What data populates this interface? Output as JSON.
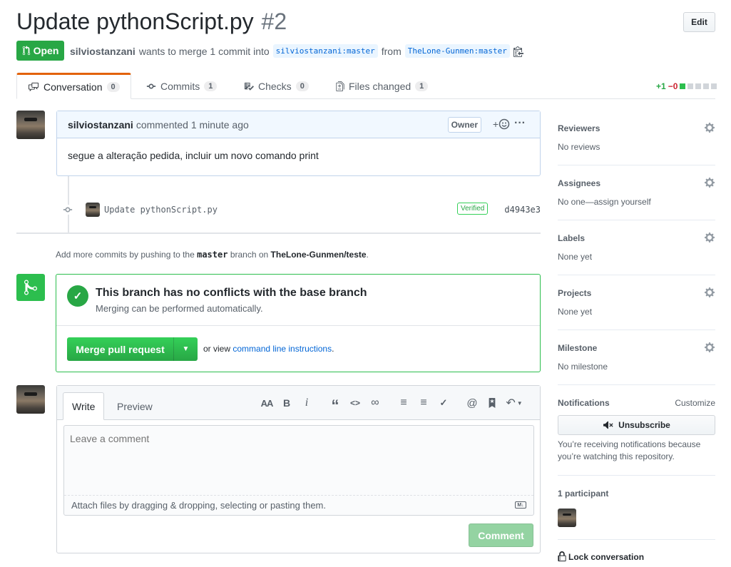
{
  "header": {
    "title": "Update pythonScript.py",
    "number": "#2",
    "edit_label": "Edit",
    "state": "Open",
    "author": "silviostanzani",
    "merge_text": "wants to merge 1 commit into",
    "base_branch": "silviostanzani:master",
    "from_text": "from",
    "head_branch": "TheLone-Gunmen:master"
  },
  "tabs": [
    {
      "label": "Conversation",
      "count": "0",
      "icon": "comment-icon"
    },
    {
      "label": "Commits",
      "count": "1",
      "icon": "commit-icon"
    },
    {
      "label": "Checks",
      "count": "0",
      "icon": "checklist-icon"
    },
    {
      "label": "Files changed",
      "count": "1",
      "icon": "file-diff-icon"
    }
  ],
  "diffstat": {
    "added": "+1",
    "removed": "−0"
  },
  "comment": {
    "author": "silviostanzani",
    "meta": "commented 1 minute ago",
    "badge": "Owner",
    "react": "+",
    "body": "segue a alteração pedida, incluir um novo comando print"
  },
  "commit": {
    "message": "Update pythonScript.py",
    "verified": "Verified",
    "sha": "d4943e3"
  },
  "add_commits": {
    "prefix": "Add more commits by pushing to the",
    "branch": "master",
    "middle": "branch on",
    "repo": "TheLone-Gunmen/teste",
    "suffix": "."
  },
  "merge": {
    "title": "This branch has no conflicts with the base branch",
    "subtitle": "Merging can be performed automatically.",
    "button": "Merge pull request",
    "or_view": "or view",
    "link": "command line instructions",
    "suffix": "."
  },
  "form": {
    "tab_write": "Write",
    "tab_preview": "Preview",
    "placeholder": "Leave a comment",
    "attach": "Attach files by dragging & dropping, selecting or pasting them.",
    "submit": "Comment",
    "toolbar": {
      "heading": "AA",
      "bold": "B",
      "italic": "i",
      "quote": "“",
      "code": "<>",
      "link": "∞",
      "ul": "≡",
      "ol": "≡",
      "tasks": "✓",
      "mention": "@",
      "bookmark": "⬢",
      "reply": "↶"
    }
  },
  "sidebar": {
    "reviewers": {
      "head": "Reviewers",
      "value": "No reviews"
    },
    "assignees": {
      "head": "Assignees",
      "value": "No one—assign yourself"
    },
    "labels": {
      "head": "Labels",
      "value": "None yet"
    },
    "projects": {
      "head": "Projects",
      "value": "None yet"
    },
    "milestone": {
      "head": "Milestone",
      "value": "No milestone"
    },
    "notifications": {
      "head": "Notifications",
      "customize": "Customize",
      "unsubscribe": "Unsubscribe",
      "text": "You’re receiving notifications because you’re watching this repository."
    },
    "participants": {
      "head": "1 participant"
    },
    "lock": "Lock conversation"
  },
  "colors": {
    "green": "#28a745",
    "blue_link": "#0366d6",
    "tab_accent": "#e36209"
  }
}
